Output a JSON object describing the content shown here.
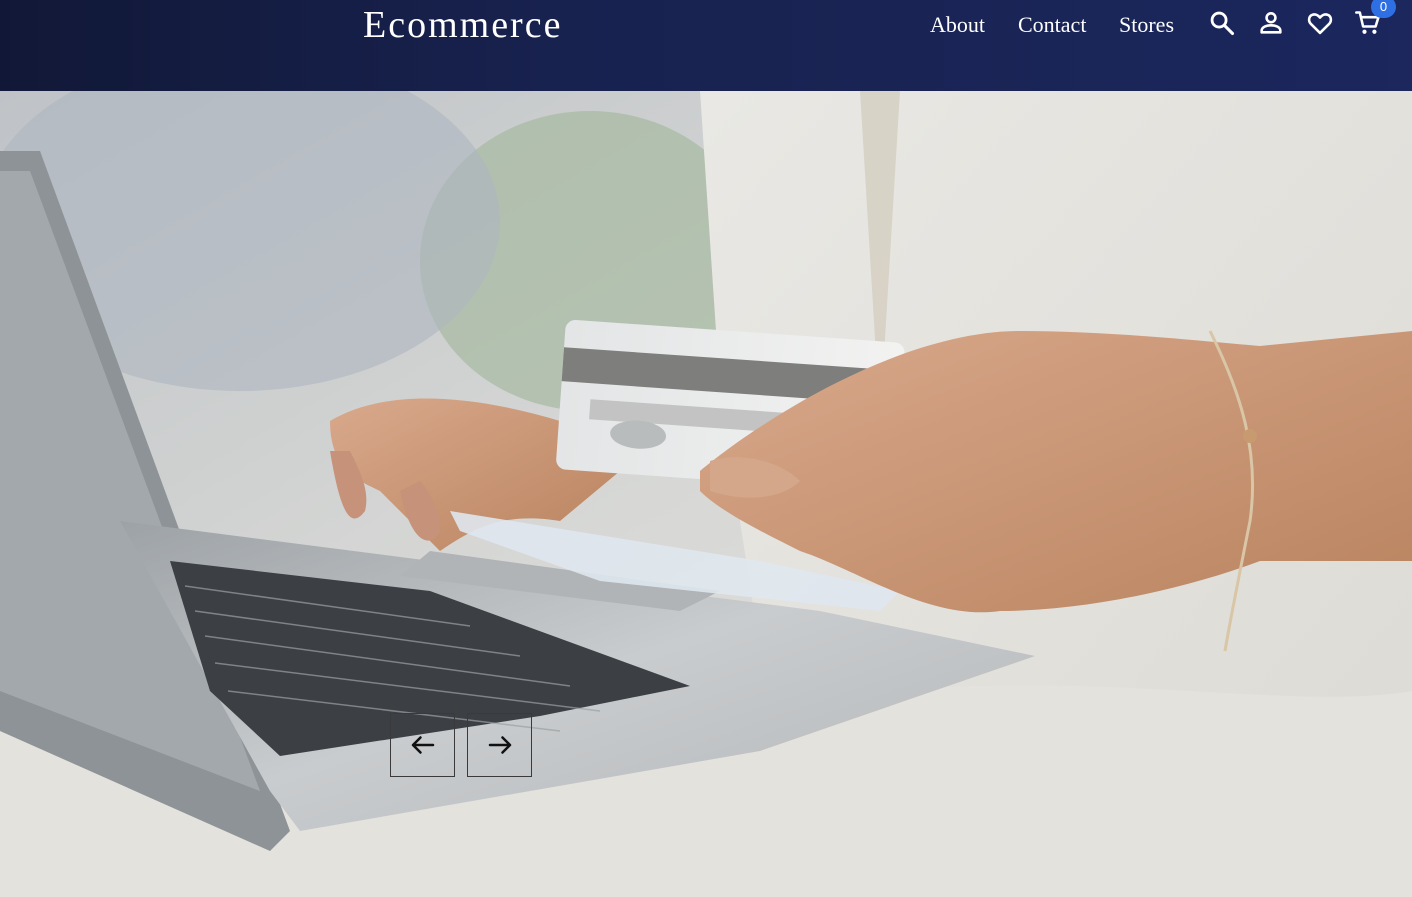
{
  "header": {
    "brand": "Ecommerce",
    "nav": [
      {
        "label": "About"
      },
      {
        "label": "Contact"
      },
      {
        "label": "Stores"
      }
    ],
    "icons": [
      "search-icon",
      "user-icon",
      "heart-icon",
      "cart-icon"
    ],
    "cart_count": "0"
  },
  "hero": {
    "image": "person-holding-credit-card-at-laptop",
    "controls": {
      "prev_icon": "arrow-left-icon",
      "next_icon": "arrow-right-icon"
    }
  },
  "colors": {
    "header_bg": "#1b275d",
    "badge": "#2f6fe4",
    "text": "#ffffff"
  }
}
